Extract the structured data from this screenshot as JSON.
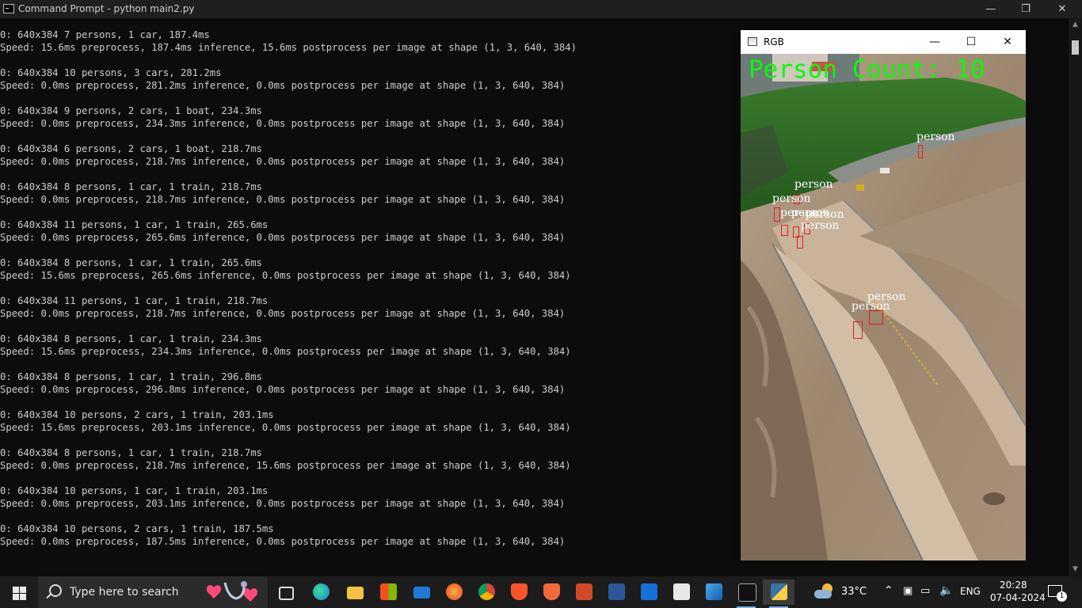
{
  "window": {
    "title": "Command Prompt - python  main2.py",
    "minimize": "—",
    "maximize": "❐",
    "close": "✕"
  },
  "console": {
    "lines": [
      "0: 640x384 7 persons, 1 car, 187.4ms",
      "Speed: 15.6ms preprocess, 187.4ms inference, 15.6ms postprocess per image at shape (1, 3, 640, 384)",
      "",
      "0: 640x384 10 persons, 3 cars, 281.2ms",
      "Speed: 0.0ms preprocess, 281.2ms inference, 0.0ms postprocess per image at shape (1, 3, 640, 384)",
      "",
      "0: 640x384 9 persons, 2 cars, 1 boat, 234.3ms",
      "Speed: 0.0ms preprocess, 234.3ms inference, 0.0ms postprocess per image at shape (1, 3, 640, 384)",
      "",
      "0: 640x384 6 persons, 2 cars, 1 boat, 218.7ms",
      "Speed: 0.0ms preprocess, 218.7ms inference, 0.0ms postprocess per image at shape (1, 3, 640, 384)",
      "",
      "0: 640x384 8 persons, 1 car, 1 train, 218.7ms",
      "Speed: 0.0ms preprocess, 218.7ms inference, 0.0ms postprocess per image at shape (1, 3, 640, 384)",
      "",
      "0: 640x384 11 persons, 1 car, 1 train, 265.6ms",
      "Speed: 0.0ms preprocess, 265.6ms inference, 0.0ms postprocess per image at shape (1, 3, 640, 384)",
      "",
      "0: 640x384 8 persons, 1 car, 1 train, 265.6ms",
      "Speed: 15.6ms preprocess, 265.6ms inference, 0.0ms postprocess per image at shape (1, 3, 640, 384)",
      "",
      "0: 640x384 11 persons, 1 car, 1 train, 218.7ms",
      "Speed: 0.0ms preprocess, 218.7ms inference, 0.0ms postprocess per image at shape (1, 3, 640, 384)",
      "",
      "0: 640x384 8 persons, 1 car, 1 train, 234.3ms",
      "Speed: 15.6ms preprocess, 234.3ms inference, 0.0ms postprocess per image at shape (1, 3, 640, 384)",
      "",
      "0: 640x384 8 persons, 1 car, 1 train, 296.8ms",
      "Speed: 0.0ms preprocess, 296.8ms inference, 0.0ms postprocess per image at shape (1, 3, 640, 384)",
      "",
      "0: 640x384 10 persons, 2 cars, 1 train, 203.1ms",
      "Speed: 15.6ms preprocess, 203.1ms inference, 0.0ms postprocess per image at shape (1, 3, 640, 384)",
      "",
      "0: 640x384 8 persons, 1 car, 1 train, 218.7ms",
      "Speed: 0.0ms preprocess, 218.7ms inference, 15.6ms postprocess per image at shape (1, 3, 640, 384)",
      "",
      "0: 640x384 10 persons, 1 car, 1 train, 203.1ms",
      "Speed: 0.0ms preprocess, 203.1ms inference, 0.0ms postprocess per image at shape (1, 3, 640, 384)",
      "",
      "0: 640x384 10 persons, 2 cars, 1 train, 187.5ms",
      "Speed: 0.0ms preprocess, 187.5ms inference, 0.0ms postprocess per image at shape (1, 3, 640, 384)"
    ]
  },
  "rgb_window": {
    "title": "RGB",
    "minimize": "—",
    "maximize": "☐",
    "close": "✕",
    "hud_text": "Person Count: 10",
    "detection_label": "person"
  },
  "taskbar": {
    "search_placeholder": "Type here to search",
    "temperature": "33°C",
    "language": "ENG",
    "time": "20:28",
    "date": "07-04-2024",
    "notification_count": "1"
  },
  "colors": {
    "console_bg": "#0c0c0c",
    "console_text": "#cccccc",
    "hud_green": "#00ff00",
    "box_red": "#e02020"
  }
}
